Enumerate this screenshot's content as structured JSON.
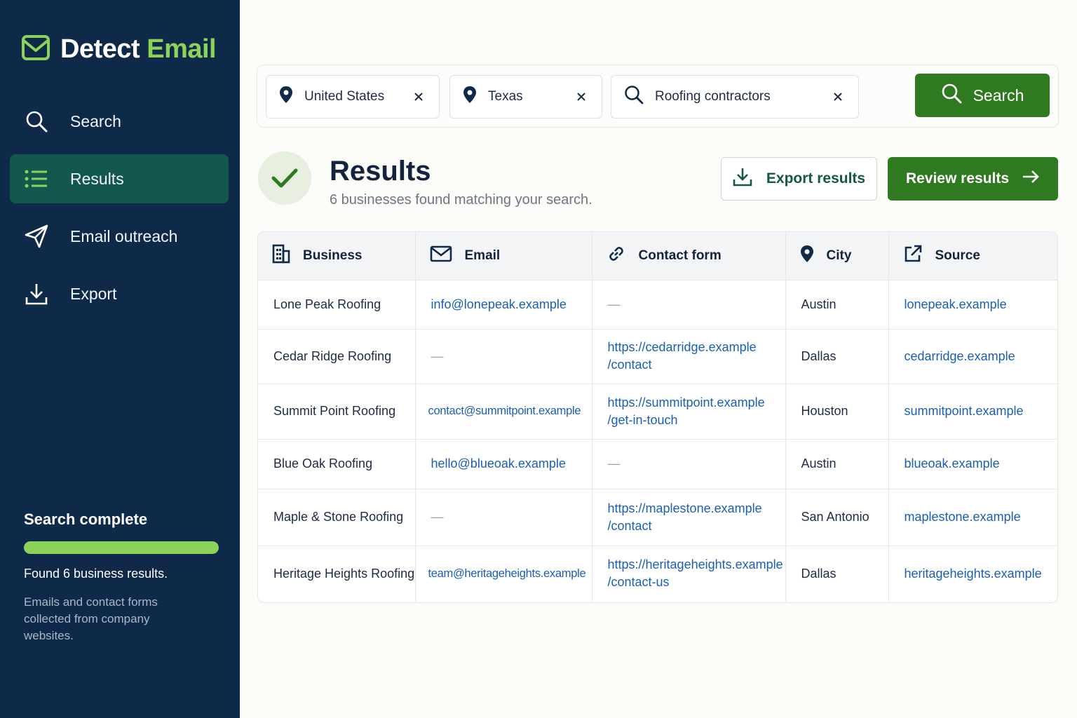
{
  "app": {
    "name_part1": "Detect",
    "name_part2": "Email",
    "accent_color": "#8dd35a",
    "sidebar_color": "#0f2a48",
    "primary_green": "#2f7a21"
  },
  "nav": {
    "items": [
      {
        "label": "Search",
        "icon": "search-icon"
      },
      {
        "label": "Results",
        "icon": "list-icon",
        "active": true
      },
      {
        "label": "Email outreach",
        "icon": "send-icon"
      },
      {
        "label": "Export",
        "icon": "download-icon"
      }
    ]
  },
  "status": {
    "title": "Search complete",
    "progress": 1.0,
    "found": "Found 6 business results.",
    "note": "Emails and contact forms collected from company websites."
  },
  "search": {
    "country": "United States",
    "state": "Texas",
    "query": "Roofing contractors",
    "button_label": "Search"
  },
  "results": {
    "title": "Results",
    "subtitle": "6 businesses found matching your search.",
    "export_label": "Export results",
    "review_label": "Review results"
  },
  "table": {
    "headers": {
      "business": "Business",
      "email": "Email",
      "contact_form": "Contact form",
      "city": "City",
      "source": "Source"
    },
    "rows": [
      {
        "business": "Lone Peak Roofing",
        "email": "info@lonepeak.example",
        "contact_form_1": "—",
        "contact_form_2": "",
        "city": "Austin",
        "source": "lonepeak.example"
      },
      {
        "business": "Cedar Ridge Roofing",
        "email": "—",
        "contact_form_1": "https://cedarridge.example",
        "contact_form_2": "/contact",
        "city": "Dallas",
        "source": "cedarridge.example"
      },
      {
        "business": "Summit Point Roofing",
        "email": "contact@summitpoint.example",
        "contact_form_1": "https://summitpoint.example",
        "contact_form_2": "/get-in-touch",
        "city": "Houston",
        "source": "summitpoint.example"
      },
      {
        "business": "Blue Oak Roofing",
        "email": "hello@blueoak.example",
        "contact_form_1": "—",
        "contact_form_2": "",
        "city": "Austin",
        "source": "blueoak.example"
      },
      {
        "business": "Maple & Stone Roofing",
        "email": "—",
        "contact_form_1": "https://maplestone.example",
        "contact_form_2": "/contact",
        "city": "San Antonio",
        "source": "maplestone.example"
      },
      {
        "business": "Heritage Heights Roofing",
        "email": "team@heritageheights.example",
        "contact_form_1": "https://heritageheights.example",
        "contact_form_2": "/contact-us",
        "city": "Dallas",
        "source": "heritageheights.example"
      }
    ]
  }
}
